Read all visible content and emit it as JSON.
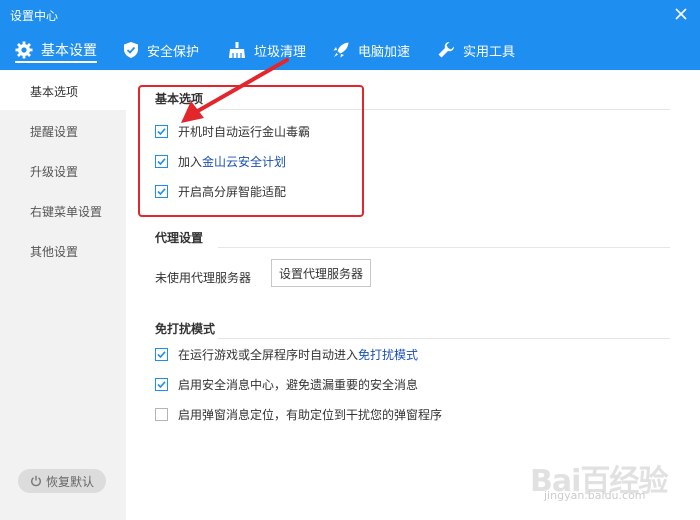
{
  "window": {
    "title": "设置中心"
  },
  "tabs": [
    {
      "label": "基本设置",
      "icon": "gear-icon"
    },
    {
      "label": "安全保护",
      "icon": "shield-icon"
    },
    {
      "label": "垃圾清理",
      "icon": "broom-icon"
    },
    {
      "label": "电脑加速",
      "icon": "rocket-icon"
    },
    {
      "label": "实用工具",
      "icon": "wrench-icon"
    }
  ],
  "sidebar": {
    "items": [
      "基本选项",
      "提醒设置",
      "升级设置",
      "右键菜单设置",
      "其他设置"
    ],
    "restore_label": "恢复默认"
  },
  "basic": {
    "title": "基本选项",
    "options": [
      {
        "label": "开机时自动运行金山毒霸",
        "checked": true
      },
      {
        "label": "加入 ",
        "link": "金山云安全计划",
        "checked": true
      },
      {
        "label": "开启高分屏智能适配",
        "checked": true
      }
    ]
  },
  "proxy": {
    "title": "代理设置",
    "status": "未使用代理服务器",
    "button_label": "设置代理服务器"
  },
  "dnd": {
    "title": "免打扰模式",
    "options": [
      {
        "label": "在运行游戏或全屏程序时自动进入 ",
        "link": "免打扰模式",
        "checked": true
      },
      {
        "label": "启用安全消息中心，避免遗漏重要的安全消息",
        "checked": true
      },
      {
        "label": "启用弹窗消息定位，有助定位到干扰您的弹窗程序",
        "checked": false
      }
    ]
  },
  "watermark": {
    "text": "Bai百经验",
    "sub": "jingyan.baidu.com"
  },
  "colors": {
    "accent": "#1f8ef1",
    "highlight": "#e3262c",
    "link": "#1a4fb8"
  }
}
